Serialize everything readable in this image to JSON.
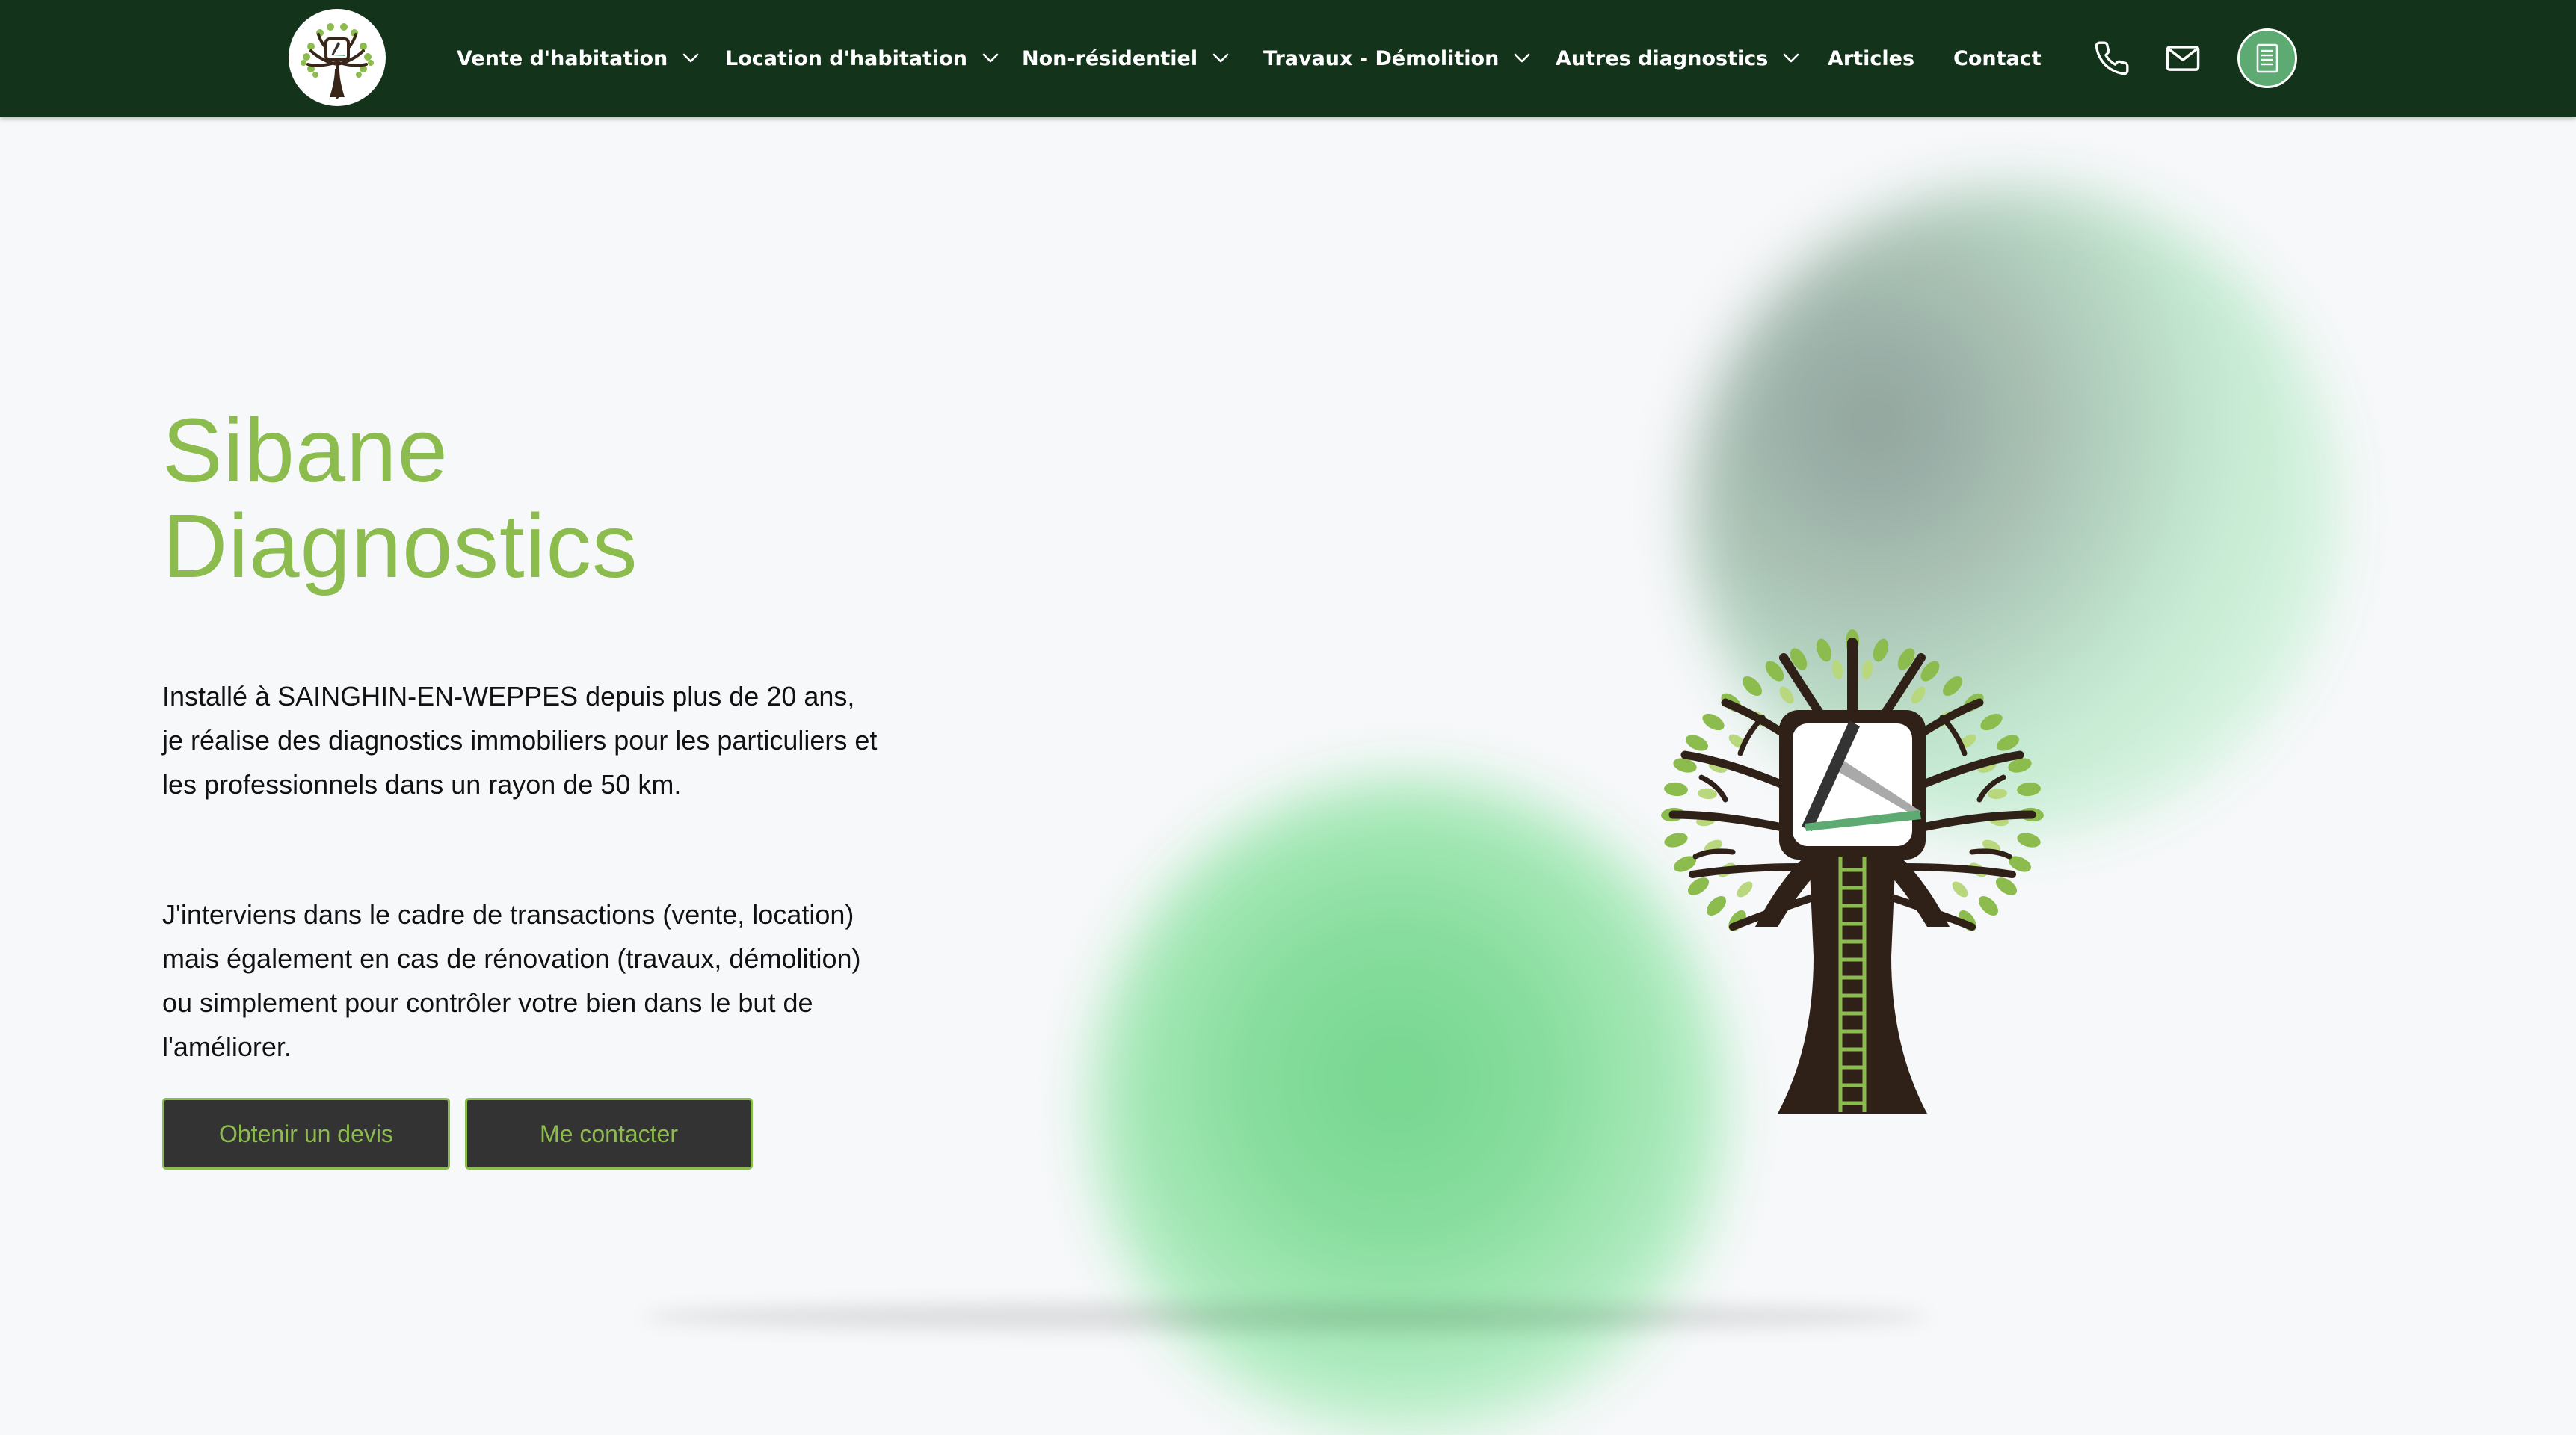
{
  "brand": {
    "logo_alt": "Sibane Diagnostics tree logo",
    "logo_icon": "tree-house-icon"
  },
  "nav": {
    "items": [
      {
        "label": "Vente d'habitation",
        "has_dropdown": true
      },
      {
        "label": "Location d'habitation",
        "has_dropdown": true
      },
      {
        "label": "Non-résidentiel",
        "has_dropdown": true
      },
      {
        "label": "Travaux - Démolition",
        "has_dropdown": true
      },
      {
        "label": "Autres diagnostics",
        "has_dropdown": true
      },
      {
        "label": "Articles",
        "has_dropdown": false
      },
      {
        "label": "Contact",
        "has_dropdown": false
      }
    ],
    "icons": [
      "phone-icon",
      "mail-icon",
      "document-icon"
    ]
  },
  "hero": {
    "title_line1": "Sibane",
    "title_line2": "Diagnostics",
    "paragraph1": "Installé à SAINGHIN-EN-WEPPES depuis plus de 20 ans, je réalise des diagnostics immobiliers pour les particuliers et les professionnels dans un rayon de 50 km.",
    "paragraph2": "J'interviens dans le cadre de transactions (vente, location) mais également en cas de rénovation (travaux, démolition) ou simplement pour contrôler votre bien dans le but de l'améliorer.",
    "cta_primary": "Obtenir un devis",
    "cta_secondary": "Me contacter"
  },
  "colors": {
    "nav_background": "#13331a",
    "accent_green": "#8cbc4e",
    "button_background": "#333333",
    "icon_button": "#5dab73",
    "tree_trunk": "#3a2618",
    "page_background": "#f7f8fa"
  }
}
